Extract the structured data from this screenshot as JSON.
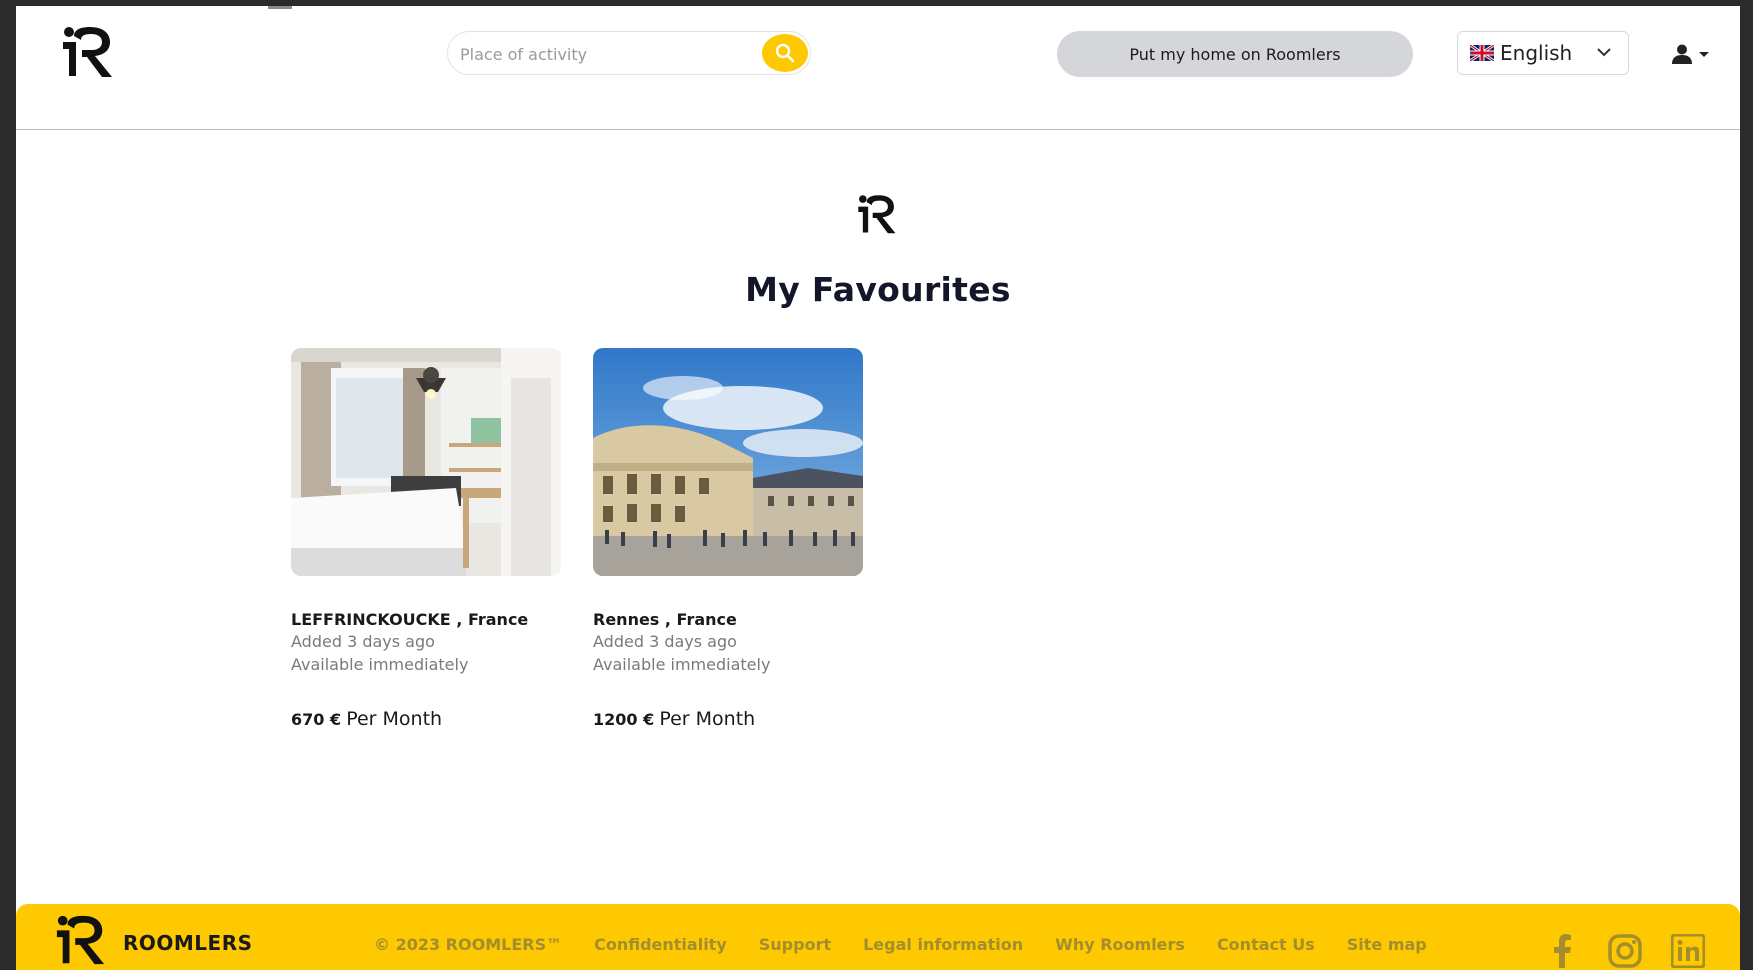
{
  "header": {
    "search_placeholder": "Place of activity",
    "host_button": "Put my home on Roomlers",
    "language": "English"
  },
  "main": {
    "title": "My Favourites",
    "listings": [
      {
        "location": "LEFFRINCKOUCKE , France",
        "added": "Added 3 days ago",
        "availability": "Available immediately",
        "price": "670 €",
        "period": "Per Month"
      },
      {
        "location": "Rennes , France",
        "added": "Added 3 days ago",
        "availability": "Available immediately",
        "price": "1200 €",
        "period": "Per Month"
      }
    ]
  },
  "footer": {
    "brand": "ROOMLERS",
    "copyright": "© 2023 ROOMLERS™",
    "links": [
      "Confidentiality",
      "Support",
      "Legal information",
      "Why Roomlers",
      "Contact Us",
      "Site map"
    ]
  },
  "colors": {
    "accent": "#fec900",
    "host_button_bg": "#d5d6da",
    "title": "#14172b",
    "footer_link": "#a48d2c"
  },
  "icons": [
    "roomlers-logo",
    "search-icon",
    "uk-flag-icon",
    "chevron-down-icon",
    "user-icon",
    "caret-down-icon",
    "facebook-icon",
    "instagram-icon",
    "linkedin-icon"
  ]
}
